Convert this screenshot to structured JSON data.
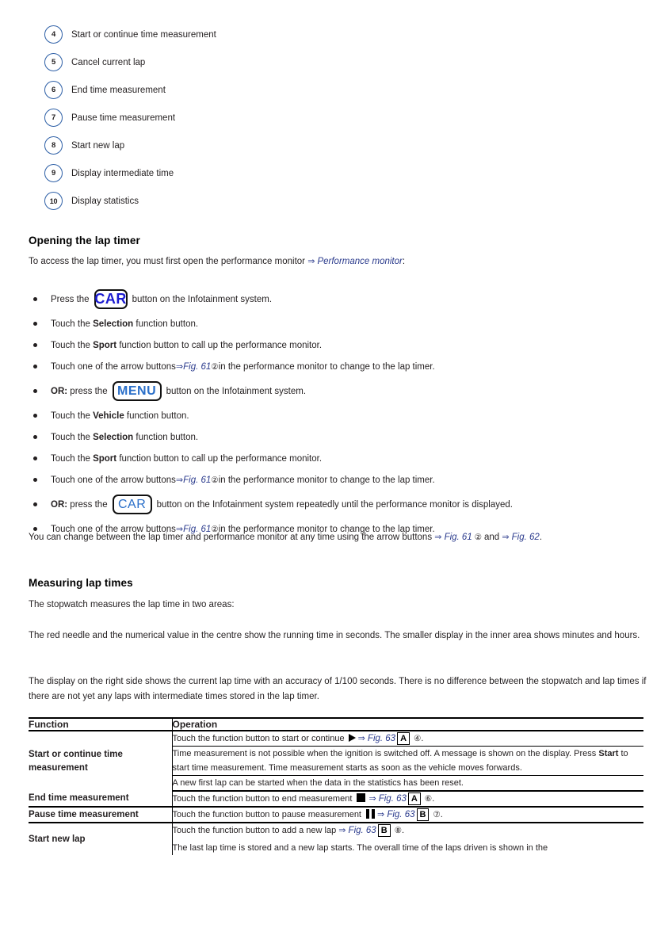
{
  "legend": {
    "items": [
      {
        "num": "4",
        "label": "Start or continue time measurement"
      },
      {
        "num": "5",
        "label": "Cancel current lap"
      },
      {
        "num": "6",
        "label": "End time measurement"
      },
      {
        "num": "7",
        "label": "Pause time measurement"
      },
      {
        "num": "8",
        "label": "Start new lap"
      },
      {
        "num": "9",
        "label": "Display intermediate time"
      },
      {
        "num": "10",
        "label": "Display statistics"
      }
    ]
  },
  "opening": {
    "heading": "Opening the lap timer",
    "intro_pre": "To access the lap timer, you must first open the performance monitor ",
    "intro_ref_arrow": "⇒ ",
    "intro_ref": "Performance monitor",
    "intro_post": ":",
    "bullets": {
      "b1_pre": "Press the",
      "b1_key": "CAR",
      "b1_post": "button on the Infotainment system.",
      "b2_pre": "Touch the",
      "b2_bold": "Selection",
      "b2_post": "function button.",
      "b3_pre": "Touch the",
      "b3_bold": "Sport",
      "b3_post": "function button to call up the performance monitor.",
      "b4_pre": "Touch one of the arrow buttons ",
      "b4_arrow": "⇒ ",
      "b4_ref": "Fig. 61",
      "b4_circ": " ② ",
      "b4_post": "in the performance monitor to change to the lap timer.",
      "b5_or": "OR:",
      "b5_pre": "press the",
      "b5_key": "MENU",
      "b5_post": "button on the Infotainment system.",
      "b6_pre": "Touch the",
      "b6_bold": "Vehicle",
      "b6_post": "function button.",
      "b7_pre": "Touch the",
      "b7_bold": "Selection",
      "b7_post": "function button.",
      "b8_pre": "Touch the",
      "b8_bold": "Sport",
      "b8_post": "function button to call up the performance monitor.",
      "b9_pre": "Touch one of the arrow buttons ",
      "b9_arrow": "⇒ ",
      "b9_ref": "Fig. 61",
      "b9_circ": " ② ",
      "b9_post": "in the performance monitor to change to the lap timer.",
      "b10_or": "OR:",
      "b10_pre": "press the",
      "b10_key": "CAR",
      "b10_post": "button on the Infotainment system repeatedly until the performance monitor is displayed.",
      "b11_pre": "Touch one of the arrow buttons ",
      "b11_arrow": "⇒ ",
      "b11_ref": "Fig. 61",
      "b11_circ": " ② ",
      "b11_post": "in the performance monitor to change to the lap timer."
    },
    "closing_pre": "You can change between the lap timer and performance monitor at any time using the arrow buttons ",
    "closing_arrow1": "⇒ ",
    "closing_ref1": "Fig. 61",
    "closing_circ1": " ② ",
    "closing_mid": "and ",
    "closing_arrow2": "⇒ ",
    "closing_ref2": "Fig. 62",
    "closing_post": "."
  },
  "measuring": {
    "heading": "Measuring lap times",
    "p1": "The stopwatch measures the lap time in two areas:",
    "p2": "The red needle and the numerical value in the centre show the running time in seconds. The smaller display in the inner area shows minutes and hours.",
    "p3": "The display on the right side shows the current lap time with an accuracy of 1/100 seconds. There is no difference between the stopwatch and lap times if there are not yet any laps with intermediate times stored in the lap timer."
  },
  "table": {
    "headers": {
      "function": "Function",
      "operation": "Operation"
    },
    "rows": [
      {
        "function": "Start or continue time measurement",
        "ops": [
          {
            "pre": "Touch the function button to start or continue ",
            "glyph": "play-icon",
            "arrow": "⇒ ",
            "ref": "Fig. 63",
            "box": "A",
            "circ": " ④",
            "post": "."
          },
          {
            "pre": "Time measurement is not possible when the ignition is switched off. A message is shown on the display. Press ",
            "bold": "Start",
            "post": " to start time measurement. Time measurement starts as soon as the vehicle moves forwards."
          },
          {
            "pre": "A new first lap can be started when the data in the statistics has been reset."
          }
        ]
      },
      {
        "function": "End time measurement",
        "ops": [
          {
            "pre": "Touch the function button to end measurement ",
            "glyph": "stop-icon",
            "arrow": "⇒ ",
            "ref": "Fig. 63",
            "box": "A",
            "circ": " ⑥",
            "post": "."
          }
        ]
      },
      {
        "function": "Pause time measurement",
        "ops": [
          {
            "pre": "Touch the function button to pause measurement ",
            "glyph": "pause-icon",
            "arrow": "⇒ ",
            "ref": "Fig. 63",
            "box": "B",
            "circ": " ⑦",
            "post": "."
          }
        ]
      },
      {
        "function": "Start new lap",
        "ops": [
          {
            "pre": "Touch the function button to add a new lap ",
            "arrow": "⇒ ",
            "ref": "Fig. 63",
            "box": "B",
            "circ": " ⑧",
            "post": "."
          },
          {
            "pre": "The last lap time is stored and a new lap starts. The overall time of the laps driven is shown in the"
          }
        ]
      }
    ]
  },
  "colors": {
    "xref_blue": "#2a3a8c",
    "key_blue": "#1b1bd1",
    "circle_blue": "#2d5fa6",
    "text": "#231f20"
  }
}
